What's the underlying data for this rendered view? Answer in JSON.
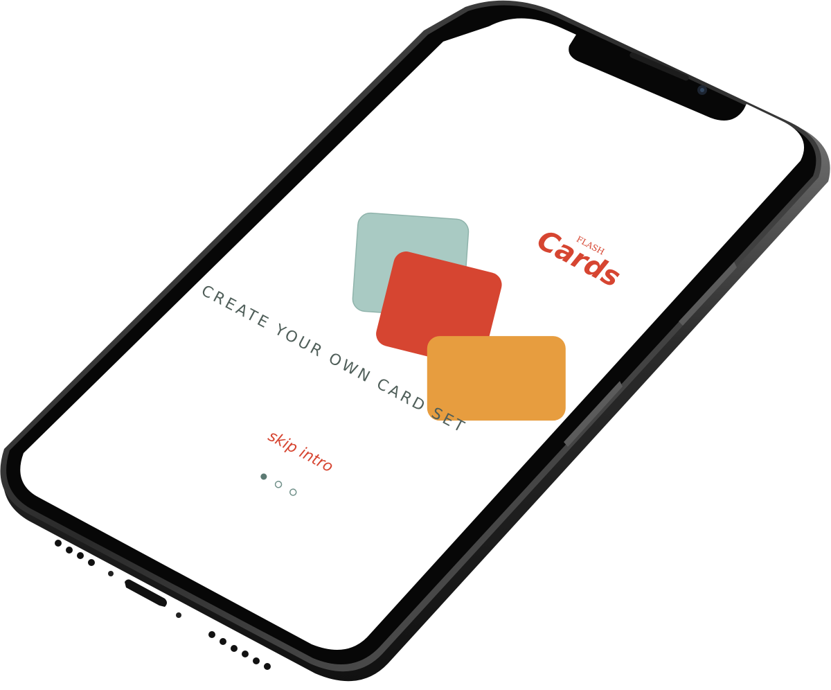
{
  "app": {
    "logo": {
      "small_text": "FLASH",
      "main_text": "Cards"
    },
    "headline": "CREATE YOUR OWN CARD SET",
    "skip_label": "skip intro",
    "pagination": {
      "total": 3,
      "active_index": 0
    }
  },
  "colors": {
    "accent_red": "#d64531",
    "card_teal": "#a9cac3",
    "card_red": "#d64531",
    "card_orange": "#e79d3f",
    "text_gray": "#4f5e59",
    "dot_active": "#5c7a73",
    "dot_inactive": "#6f8f88",
    "screen_bg": "#ffffff",
    "bezel": "#070707",
    "frame_metal": "#3c3c3c"
  },
  "icons": {
    "speaker": "earpiece-speaker-icon",
    "camera": "front-camera-icon",
    "port": "lightning-port-icon"
  }
}
